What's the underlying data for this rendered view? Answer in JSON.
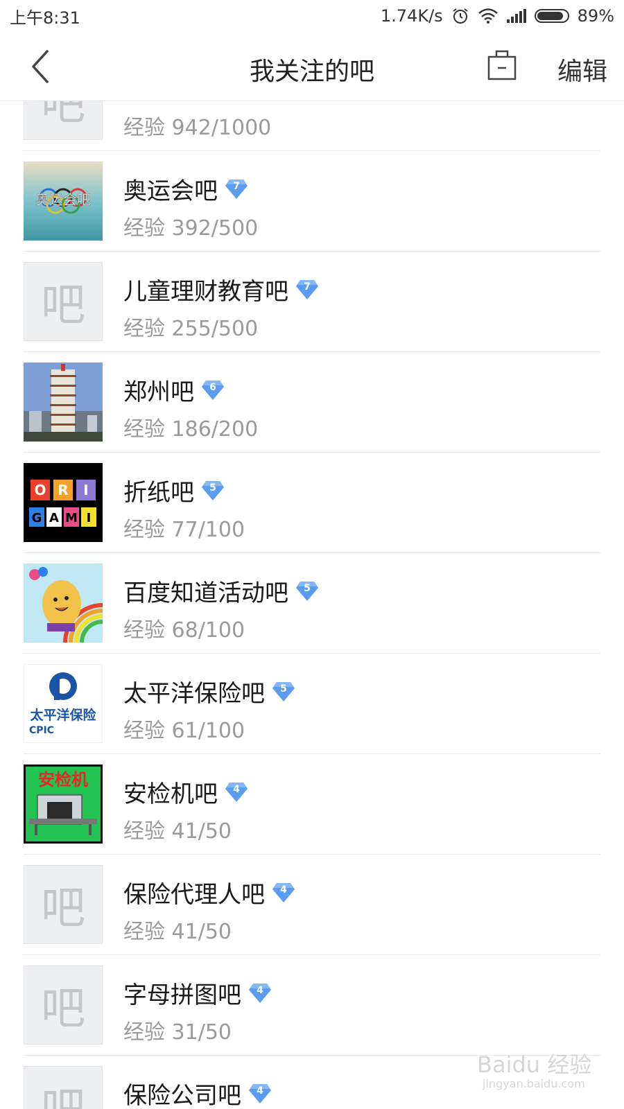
{
  "status_bar": {
    "time": "上午8:31",
    "speed": "1.74K/s",
    "battery_percent": "89%",
    "battery_level": 0.89
  },
  "nav": {
    "title": "我关注的吧",
    "edit_label": "编辑"
  },
  "placeholder_glyph": "吧",
  "items": [
    {
      "name": "",
      "exp": "经验 942/1000",
      "level": "",
      "avatar": "placeholder"
    },
    {
      "name": "奥运会吧",
      "exp": "经验 392/500",
      "level": "7",
      "avatar": "olympic-image"
    },
    {
      "name": "儿童理财教育吧",
      "exp": "经验 255/500",
      "level": "7",
      "avatar": "placeholder"
    },
    {
      "name": "郑州吧",
      "exp": "经验 186/200",
      "level": "6",
      "avatar": "tower-image"
    },
    {
      "name": "折纸吧",
      "exp": "经验 77/100",
      "level": "5",
      "avatar": "origami-image"
    },
    {
      "name": "百度知道活动吧",
      "exp": "经验 68/100",
      "level": "5",
      "avatar": "cartoon-image"
    },
    {
      "name": "太平洋保险吧",
      "exp": "经验 61/100",
      "level": "5",
      "avatar": "cpic-logo"
    },
    {
      "name": "安检机吧",
      "exp": "经验 41/50",
      "level": "4",
      "avatar": "scanner-image"
    },
    {
      "name": "保险代理人吧",
      "exp": "经验 41/50",
      "level": "4",
      "avatar": "placeholder"
    },
    {
      "name": "字母拼图吧",
      "exp": "经验 31/50",
      "level": "4",
      "avatar": "placeholder"
    },
    {
      "name": "保险公司吧",
      "exp": "",
      "level": "4",
      "avatar": "placeholder"
    }
  ],
  "avatar_text": {
    "olympic": "奥运会吧",
    "origami_top": "ORI",
    "origami_bottom": "GAMI",
    "cpic_cn": "太平洋保险",
    "cpic_en": "CPIC",
    "scanner": "安检机"
  },
  "watermark": {
    "brand": "Baidu 经验",
    "url": "jingyan.baidu.com"
  },
  "colors": {
    "badge": "#5b9bf0",
    "exp_text": "#9a9a9a",
    "divider": "#e8e8e8"
  }
}
